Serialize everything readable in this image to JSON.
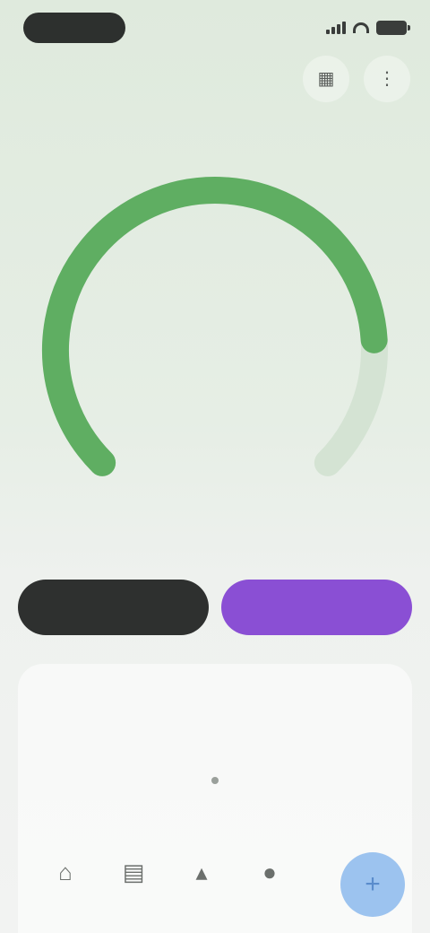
{
  "status_bar": {
    "time": ""
  },
  "header": {
    "title": "",
    "actions": [
      {
        "icon": "chart-icon",
        "glyph": "▦"
      },
      {
        "icon": "more-icon",
        "glyph": "⋮"
      }
    ]
  },
  "gauge": {
    "label": "",
    "value": "",
    "sub": "",
    "footnote": "",
    "fraction": 0.82,
    "colors": {
      "track": "#d4e3d3",
      "fill": "#5fae62"
    }
  },
  "actions": {
    "secondary_label": "",
    "primary_label": ""
  },
  "week": {
    "title": "",
    "days": [
      "",
      "",
      "",
      "",
      "",
      "",
      ""
    ],
    "today_index": 3
  },
  "nav": {
    "items": [
      {
        "icon": "home-icon",
        "glyph": "⌂"
      },
      {
        "icon": "calendar-icon",
        "glyph": "▤"
      },
      {
        "icon": "stats-icon",
        "glyph": "▴"
      },
      {
        "icon": "profile-icon",
        "glyph": "●"
      }
    ],
    "fab_icon": "add-icon",
    "fab_glyph": "+"
  },
  "colors": {
    "accent_green": "#5fae62",
    "accent_purple": "#8a4fd4",
    "dark": "#2e302f",
    "fab_blue": "#9cc3ef"
  }
}
